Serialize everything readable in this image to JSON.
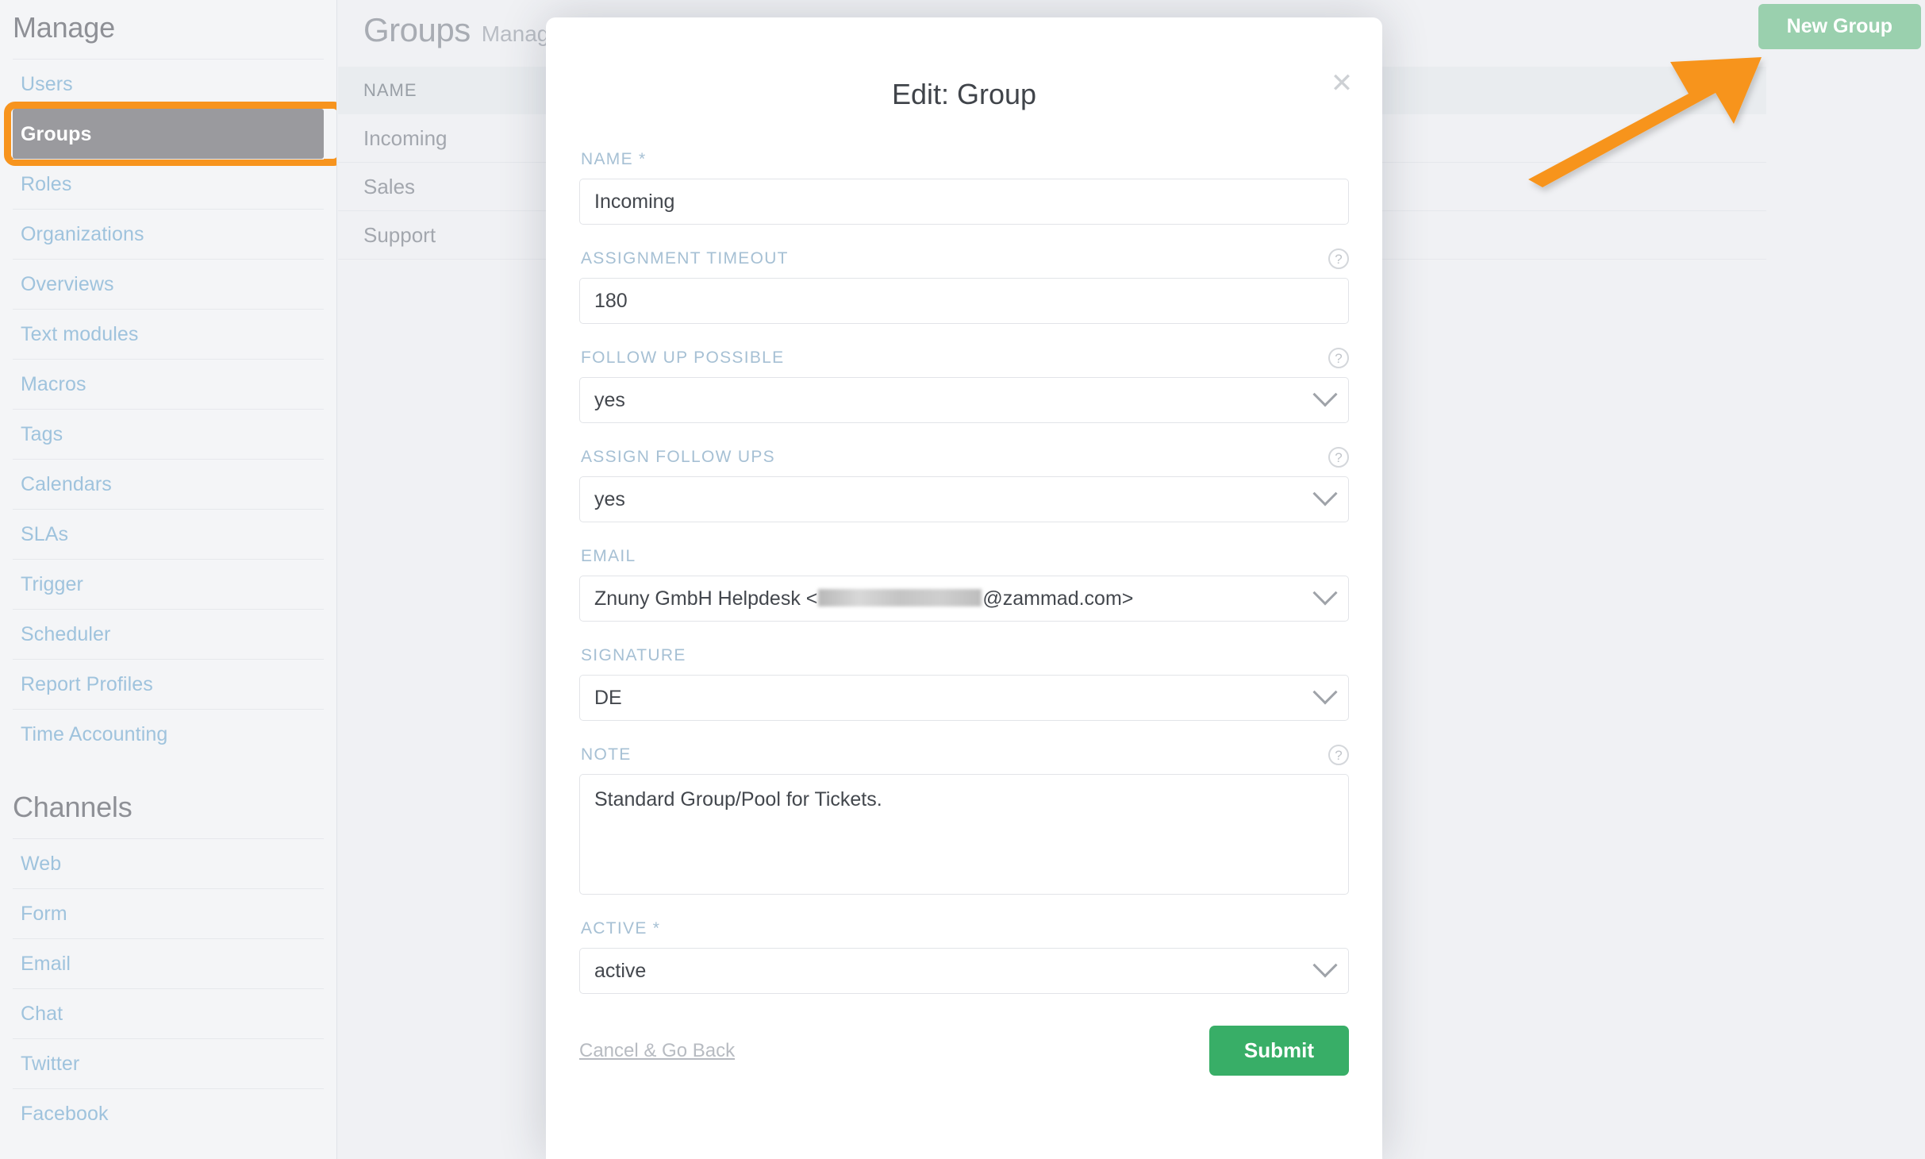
{
  "sidebar": {
    "sections": [
      {
        "heading": "Manage",
        "items": [
          {
            "label": "Users",
            "active": false
          },
          {
            "label": "Groups",
            "active": true
          },
          {
            "label": "Roles",
            "active": false
          },
          {
            "label": "Organizations",
            "active": false
          },
          {
            "label": "Overviews",
            "active": false
          },
          {
            "label": "Text modules",
            "active": false
          },
          {
            "label": "Macros",
            "active": false
          },
          {
            "label": "Tags",
            "active": false
          },
          {
            "label": "Calendars",
            "active": false
          },
          {
            "label": "SLAs",
            "active": false
          },
          {
            "label": "Trigger",
            "active": false
          },
          {
            "label": "Scheduler",
            "active": false
          },
          {
            "label": "Report Profiles",
            "active": false
          },
          {
            "label": "Time Accounting",
            "active": false
          }
        ]
      },
      {
        "heading": "Channels",
        "items": [
          {
            "label": "Web",
            "active": false
          },
          {
            "label": "Form",
            "active": false
          },
          {
            "label": "Email",
            "active": false
          },
          {
            "label": "Chat",
            "active": false
          },
          {
            "label": "Twitter",
            "active": false
          },
          {
            "label": "Facebook",
            "active": false
          }
        ]
      }
    ]
  },
  "page": {
    "title": "Groups",
    "subtitle": "Management",
    "new_group_label": "New Group",
    "table": {
      "columns": [
        "NAME"
      ],
      "rows": [
        "Incoming",
        "Sales",
        "Support"
      ]
    }
  },
  "modal": {
    "title": "Edit: Group",
    "close_icon": "✕",
    "help_icon": "?",
    "fields": {
      "name": {
        "label": "NAME *",
        "value": "Incoming",
        "help": false
      },
      "assignment_timeout": {
        "label": "ASSIGNMENT TIMEOUT",
        "value": "180",
        "help": true
      },
      "follow_up_possible": {
        "label": "FOLLOW UP POSSIBLE",
        "value": "yes",
        "help": true
      },
      "assign_follow_ups": {
        "label": "ASSIGN FOLLOW UPS",
        "value": "yes",
        "help": true
      },
      "email": {
        "label": "EMAIL",
        "value_prefix": "Znuny GmbH Helpdesk <",
        "value_suffix": "@zammad.com>",
        "redacted": true,
        "help": false
      },
      "signature": {
        "label": "SIGNATURE",
        "value": "DE",
        "help": false
      },
      "note": {
        "label": "NOTE",
        "value": "Standard Group/Pool for Tickets.",
        "help": true
      },
      "active": {
        "label": "ACTIVE *",
        "value": "active",
        "help": false
      }
    },
    "cancel_label": "Cancel & Go Back",
    "submit_label": "Submit"
  },
  "annotation": {
    "arrow_color": "#f7941e",
    "highlight_color": "#f7941e",
    "target": "New Group"
  },
  "colors": {
    "background": "#f0f1f4",
    "sidebar_bg": "#f4f5f7",
    "sidebar_link": "#9fc3dd",
    "sidebar_active_bg": "#9a9a9e",
    "new_group_green": "#9ad0ae",
    "submit_green": "#38ae67",
    "label_blue": "#a6c0d4",
    "annotation_orange": "#f7941e"
  }
}
